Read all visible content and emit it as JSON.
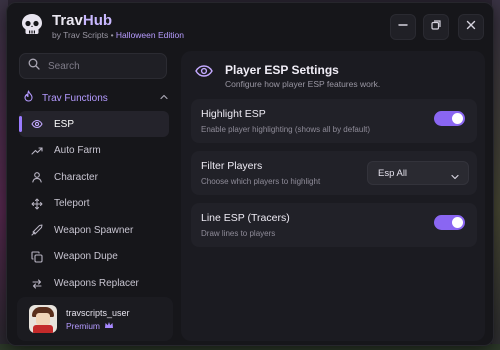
{
  "app": {
    "name_a": "Trav",
    "name_b": "Hub",
    "subtitle_prefix": "by Trav Scripts •",
    "edition": "Halloween Edition"
  },
  "window_controls": [
    "minimize-icon",
    "restore-icon",
    "close-icon"
  ],
  "search": {
    "placeholder": "Search"
  },
  "sidebar": {
    "section": {
      "label": "Trav Functions",
      "icon": "flame-icon",
      "expanded": true
    },
    "items": [
      {
        "label": "ESP",
        "icon": "eye-icon",
        "active": true
      },
      {
        "label": "Auto Farm",
        "icon": "trend-icon",
        "active": false
      },
      {
        "label": "Character",
        "icon": "user-icon",
        "active": false
      },
      {
        "label": "Teleport",
        "icon": "move-icon",
        "active": false
      },
      {
        "label": "Weapon Spawner",
        "icon": "sword-icon",
        "active": false
      },
      {
        "label": "Weapon Dupe",
        "icon": "copy-icon",
        "active": false
      },
      {
        "label": "Weapons Replacer",
        "icon": "swap-icon",
        "active": false
      }
    ]
  },
  "profile": {
    "username": "travscripts_user",
    "tier": "Premium"
  },
  "main": {
    "title": "Player ESP Settings",
    "description": "Configure how player ESP features work.",
    "settings": [
      {
        "title": "Highlight ESP",
        "description": "Enable player highlighting (shows all by default)",
        "control": "toggle",
        "enabled": true
      },
      {
        "title": "Filter Players",
        "description": "Choose which players to highlight",
        "control": "select",
        "value": "Esp All"
      },
      {
        "title": "Line ESP (Tracers)",
        "description": "Draw lines to players",
        "control": "toggle",
        "enabled": true
      }
    ]
  },
  "colors": {
    "accent": "#9b7bff",
    "toggle_on": "#8a66f2",
    "window_bg": "#16161a",
    "panel_bg": "#1b1b21",
    "card_bg": "#212128"
  }
}
